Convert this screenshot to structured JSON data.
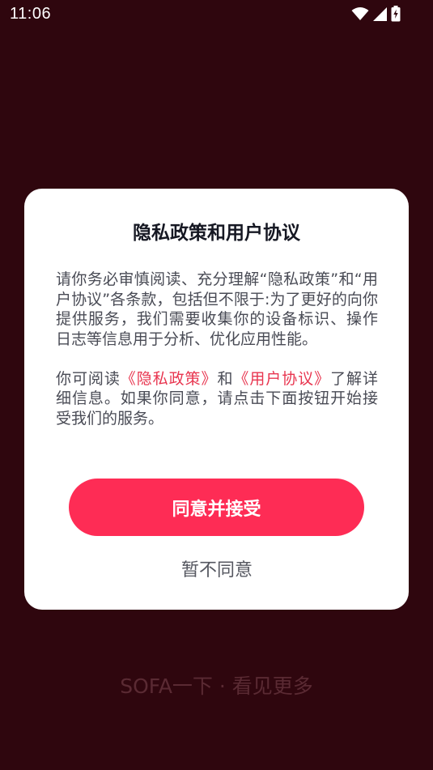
{
  "status_bar": {
    "time": "11:06",
    "icons": [
      "wifi-icon",
      "signal-icon",
      "battery-charging-icon"
    ]
  },
  "background": {
    "tagline": "SOFA一下 · 看见更多"
  },
  "dialog": {
    "title": "隐私政策和用户协议",
    "paragraph1": "请你务必审慎阅读、充分理解“隐私政策”和“用户协议”各条款，包括但不限于:为了更好的向你提供服务，我们需要收集你的设备标识、操作日志等信息用于分析、优化应用性能。",
    "paragraph2": {
      "prefix": "你可阅读",
      "privacy_link": "《隐私政策》",
      "middle": "和",
      "agreement_link": "《用户协议》",
      "suffix": "了解详细信息。如果你同意，请点击下面按钮开始接受我们的服务。"
    },
    "agree_label": "同意并接受",
    "decline_label": "暂不同意"
  },
  "colors": {
    "background": "#2f060e",
    "accent": "#fe2c55",
    "link": "#e8354f",
    "dialog": "#ffffff"
  }
}
